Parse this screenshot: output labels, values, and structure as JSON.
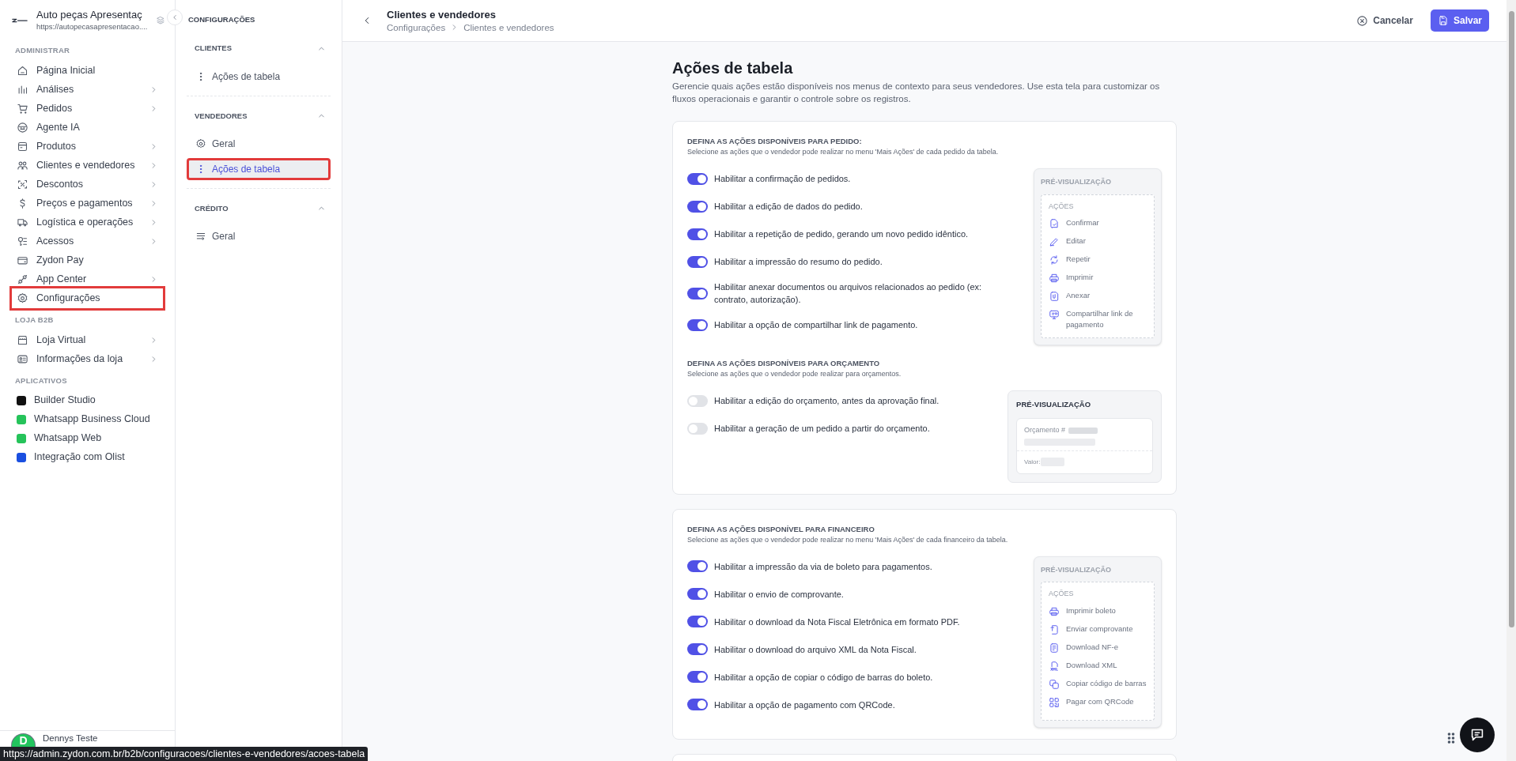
{
  "sidebar": {
    "company": {
      "name": "Auto peças Apresentaç",
      "url": "https://autopecasapresentacao...."
    },
    "sections": [
      {
        "title": "ADMINISTRAR",
        "items": [
          {
            "label": "Página Inicial",
            "expandable": false,
            "highlighted": false
          },
          {
            "label": "Análises",
            "expandable": true,
            "highlighted": false
          },
          {
            "label": "Pedidos",
            "expandable": true,
            "highlighted": false
          },
          {
            "label": "Agente IA",
            "expandable": false,
            "highlighted": false
          },
          {
            "label": "Produtos",
            "expandable": true,
            "highlighted": false
          },
          {
            "label": "Clientes e vendedores",
            "expandable": true,
            "highlighted": false
          },
          {
            "label": "Descontos",
            "expandable": true,
            "highlighted": false
          },
          {
            "label": "Preços e pagamentos",
            "expandable": true,
            "highlighted": false
          },
          {
            "label": "Logística e operações",
            "expandable": true,
            "highlighted": false
          },
          {
            "label": "Acessos",
            "expandable": true,
            "highlighted": false
          },
          {
            "label": "Zydon Pay",
            "expandable": false,
            "highlighted": false
          },
          {
            "label": "App Center",
            "expandable": true,
            "highlighted": false
          },
          {
            "label": "Configurações",
            "expandable": false,
            "highlighted": true
          }
        ]
      },
      {
        "title": "LOJA B2B",
        "items": [
          {
            "label": "Loja Virtual",
            "expandable": true,
            "highlighted": false
          },
          {
            "label": "Informações da loja",
            "expandable": true,
            "highlighted": false
          }
        ]
      },
      {
        "title": "APLICATIVOS",
        "apps": [
          {
            "label": "Builder Studio",
            "color": "#111111"
          },
          {
            "label": "Whatsapp Business Cloud",
            "color": "#25c35a"
          },
          {
            "label": "Whatsapp Web",
            "color": "#25c35a"
          },
          {
            "label": "Integração com Olist",
            "color": "#1a4fe0"
          }
        ]
      }
    ],
    "user": {
      "initial": "D",
      "name": "Dennys Teste"
    }
  },
  "subnav": {
    "title": "CONFIGURAÇÕES",
    "groups": [
      {
        "title": "CLIENTES",
        "expanded": true,
        "items": [
          {
            "label": "Ações de tabela",
            "selected": false,
            "highlighted": false
          }
        ]
      },
      {
        "title": "VENDEDORES",
        "expanded": true,
        "items": [
          {
            "label": "Geral",
            "selected": false,
            "highlighted": false
          },
          {
            "label": "Ações de tabela",
            "selected": true,
            "highlighted": true
          }
        ]
      },
      {
        "title": "CRÉDITO",
        "expanded": true,
        "items": [
          {
            "label": "Geral",
            "selected": false,
            "highlighted": false
          }
        ]
      }
    ]
  },
  "header": {
    "title": "Clientes e vendedores",
    "breadcrumb": [
      "Configurações",
      "Clientes e vendedores"
    ],
    "cancel": "Cancelar",
    "save": "Salvar"
  },
  "page": {
    "title": "Ações de tabela",
    "description": "Gerencie quais ações estão disponíveis nos menus de contexto para seus vendedores. Use esta tela para customizar os fluxos operacionais e garantir o controle sobre os registros."
  },
  "cards": [
    {
      "sections": [
        {
          "title": "DEFINA AS AÇÕES DISPONÍVEIS PARA PEDIDO:",
          "subtitle": "Selecione as ações que o vendedor pode realizar no menu 'Mais Ações' de cada pedido da tabela.",
          "options": [
            {
              "label": "Habilitar a confirmação de pedidos.",
              "on": true
            },
            {
              "label": "Habilitar a edição de dados do pedido.",
              "on": true
            },
            {
              "label": "Habilitar a repetição de pedido, gerando um novo pedido idêntico.",
              "on": true
            },
            {
              "label": "Habilitar a impressão do resumo do pedido.",
              "on": true
            },
            {
              "label": "Habilitar anexar documentos ou arquivos relacionados ao pedido (ex: contrato, autorização).",
              "on": true
            },
            {
              "label": "Habilitar a opção de compartilhar link de pagamento.",
              "on": true
            }
          ],
          "preview": {
            "kind": "actions",
            "title": "PRÉ-VISUALIZAÇÃO",
            "menu_title": "AÇÕES",
            "actions": [
              "Confirmar",
              "Editar",
              "Repetir",
              "Imprimir",
              "Anexar",
              "Compartilhar link de pagamento"
            ]
          }
        },
        {
          "title": "DEFINA AS AÇÕES DISPONÍVEIS PARA ORÇAMENTO",
          "subtitle": "Selecione as ações que o vendedor pode realizar para orçamentos.",
          "options": [
            {
              "label": "Habilitar a edição do orçamento, antes da aprovação final.",
              "on": false
            },
            {
              "label": "Habilitar a geração de um pedido a partir do orçamento.",
              "on": false
            }
          ],
          "preview": {
            "kind": "quote",
            "title": "PRÉ-VISUALIZAÇÃO",
            "number_label": "Orçamento #",
            "value_label": "Valor:"
          }
        }
      ]
    },
    {
      "sections": [
        {
          "title": "DEFINA AS AÇÕES DISPONÍVEL PARA FINANCEIRO",
          "subtitle": "Selecione as ações que o vendedor pode realizar no menu 'Mais Ações' de cada financeiro da tabela.",
          "options": [
            {
              "label": "Habilitar a impressão da via de boleto para pagamentos.",
              "on": true
            },
            {
              "label": "Habilitar o envio de comprovante.",
              "on": true
            },
            {
              "label": "Habilitar o download da Nota Fiscal Eletrônica em formato PDF.",
              "on": true
            },
            {
              "label": "Habilitar o download do arquivo XML da Nota Fiscal.",
              "on": true
            },
            {
              "label": "Habilitar a opção de copiar o código de barras do boleto.",
              "on": true
            },
            {
              "label": "Habilitar a opção de pagamento com QRCode.",
              "on": true
            }
          ],
          "preview": {
            "kind": "actions",
            "title": "PRÉ-VISUALIZAÇÃO",
            "menu_title": "AÇÕES",
            "actions": [
              "Imprimir boleto",
              "Enviar comprovante",
              "Download NF-e",
              "Download XML",
              "Copiar código de barras",
              "Pagar com QRCode"
            ]
          }
        }
      ]
    }
  ],
  "status_url": "https://admin.zydon.com.br/b2b/configuracoes/clientes-e-vendedores/acoes-tabela"
}
